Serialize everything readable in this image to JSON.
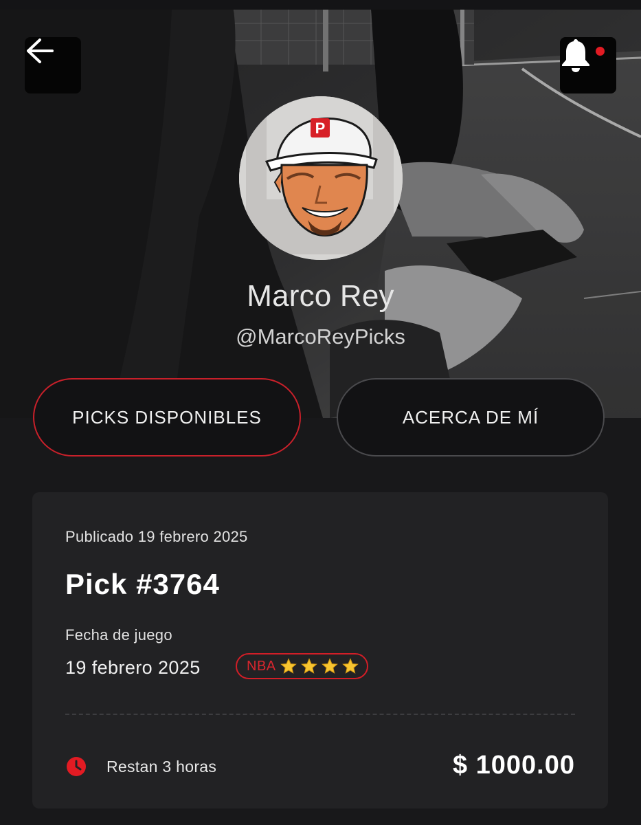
{
  "header": {
    "back_icon": "arrow-left-icon",
    "bell_icon": "bell-icon",
    "has_notification": true
  },
  "profile": {
    "name": "Marco Rey",
    "handle": "@MarcoReyPicks",
    "avatar_letter": "P"
  },
  "tabs": [
    {
      "label": "PICKS DISPONIBLES",
      "active": true
    },
    {
      "label": "ACERCA DE MÍ",
      "active": false
    }
  ],
  "pick_card": {
    "published": "Publicado 19 febrero 2025",
    "title": "Pick #3764",
    "game_date_label": "Fecha de juego",
    "game_date": "19 febrero 2025",
    "league": "NBA",
    "stars": 4,
    "time_left": "Restan 3 horas",
    "price": "$ 1000.00"
  },
  "colors": {
    "accent": "#d21e27",
    "background": "#18181a",
    "card": "#222224"
  }
}
